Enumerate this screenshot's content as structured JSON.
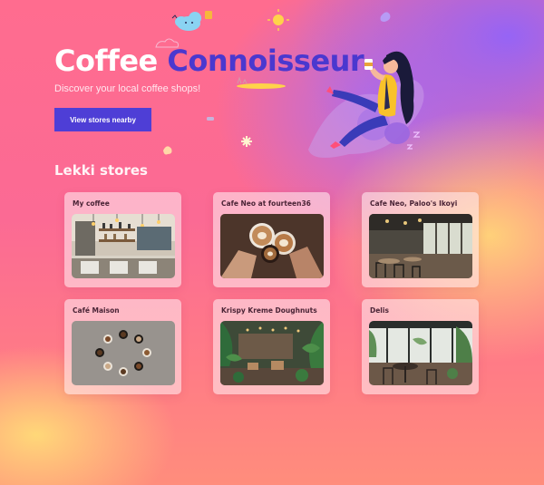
{
  "hero": {
    "title_part1": "Coffee",
    "title_part2": "Connoisseur",
    "subtitle": "Discover your local coffee shops!",
    "cta_label": "View stores nearby"
  },
  "section": {
    "title": "Lekki stores"
  },
  "stores": [
    {
      "name": "My coffee",
      "image": "bar-counter-photo"
    },
    {
      "name": "Cafe Neo at fourteen36",
      "image": "latte-cups-cheers-photo"
    },
    {
      "name": "Cafe Neo, Paloo's Ikoyi",
      "image": "cafe-interior-photo"
    },
    {
      "name": "Café Maison",
      "image": "coffee-cups-circle-photo"
    },
    {
      "name": "Krispy Kreme Doughnuts",
      "image": "plant-filled-cafe-photo"
    },
    {
      "name": "Delis",
      "image": "window-table-photo"
    }
  ],
  "colors": {
    "brand": "#4a38cf",
    "button": "#4e3ed6"
  }
}
